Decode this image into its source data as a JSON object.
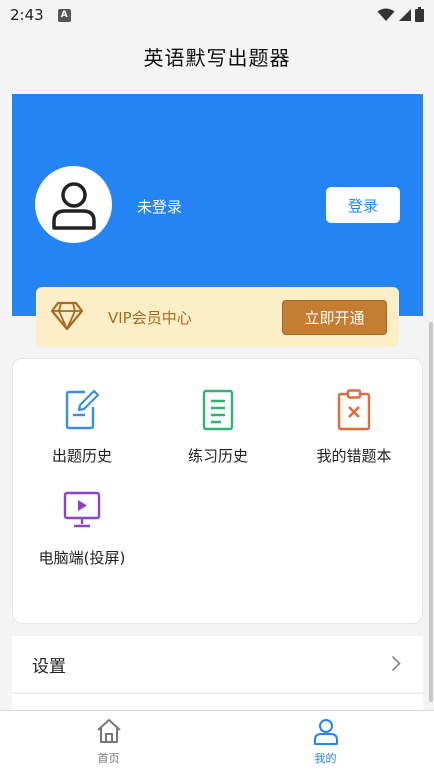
{
  "status": {
    "time": "2:43",
    "notif_letter": "A"
  },
  "app": {
    "title": "英语默写出题器"
  },
  "profile": {
    "username": "未登录",
    "login_label": "登录"
  },
  "vip": {
    "label": "VIP会员中心",
    "button_label": "立即开通"
  },
  "menu": {
    "items": [
      {
        "label": "出题历史",
        "icon": "edit-document-icon",
        "color": "#3a8ee6"
      },
      {
        "label": "练习历史",
        "icon": "list-document-icon",
        "color": "#2bb673"
      },
      {
        "label": "我的错题本",
        "icon": "clipboard-x-icon",
        "color": "#e06c3c"
      },
      {
        "label": "电脑端(投屏)",
        "icon": "monitor-play-icon",
        "color": "#8e44c4"
      }
    ]
  },
  "settings": {
    "label": "设置"
  },
  "tabs": [
    {
      "label": "首页",
      "icon": "home-icon",
      "active": false
    },
    {
      "label": "我的",
      "icon": "user-icon",
      "active": true
    }
  ],
  "colors": {
    "primary": "#2584f4",
    "vip_bg": "#fcefc7",
    "vip_btn": "#c47d33",
    "tab_inactive": "#777777"
  }
}
